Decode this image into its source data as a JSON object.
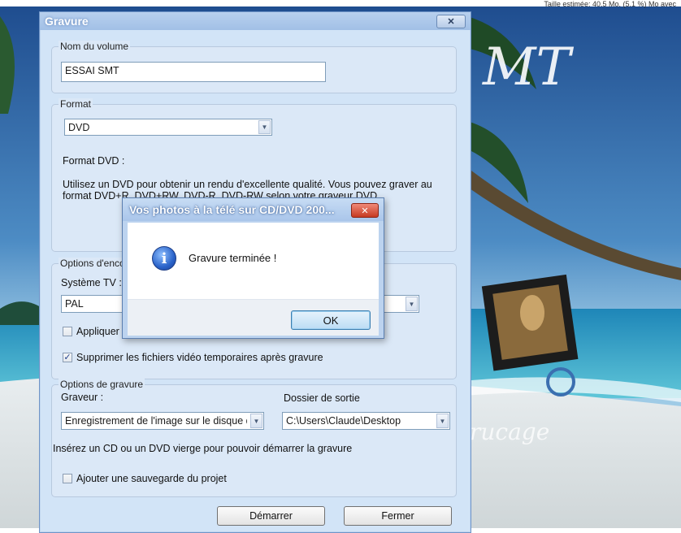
{
  "background": {
    "top_right_text": "Taille estimée: 40.5 Mo. (5.1 %) Mo avec",
    "watermark_top": "MT",
    "watermark_bottom": "rucage"
  },
  "main_window": {
    "title": "Gravure",
    "close_label": "✕",
    "volume": {
      "label": "Nom du volume",
      "value": "ESSAI SMT"
    },
    "format": {
      "label": "Format",
      "selected": "DVD",
      "heading": "Format DVD :",
      "description_line1": "Utilisez un DVD pour obtenir un rendu d'excellente qualité. Vous pouvez graver au",
      "description_line2": "format DVD+R, DVD+RW, DVD-R, DVD-RW selon votre graveur DVD."
    },
    "encoding": {
      "label": "Options d'enco",
      "tv_system_label": "Système TV :",
      "tv_system_value": "PAL",
      "apply_label": "Appliquer l",
      "delete_temp_label": "Supprimer les fichiers vidéo temporaires après gravure",
      "delete_temp_checked": true
    },
    "burn": {
      "label": "Options de gravure",
      "burner_label": "Graveur :",
      "burner_value": "Enregistrement de l'image sur le disque d",
      "output_label": "Dossier de sortie",
      "output_value": "C:\\Users\\Claude\\Desktop",
      "insert_hint": "Insérez un CD ou un DVD vierge pour pouvoir démarrer la gravure",
      "backup_label": "Ajouter une sauvegarde du projet",
      "backup_checked": false
    },
    "start_button": "Démarrer",
    "close_button": "Fermer"
  },
  "message_box": {
    "title": "Vos photos à la télé sur CD/DVD 200...",
    "close_label": "✕",
    "icon": "info-icon",
    "message": "Gravure terminée !",
    "ok_label": "OK"
  },
  "colors": {
    "window_bg": "#d2e4f7",
    "close_red": "#c63a22",
    "ok_border": "#3c7fb1"
  }
}
